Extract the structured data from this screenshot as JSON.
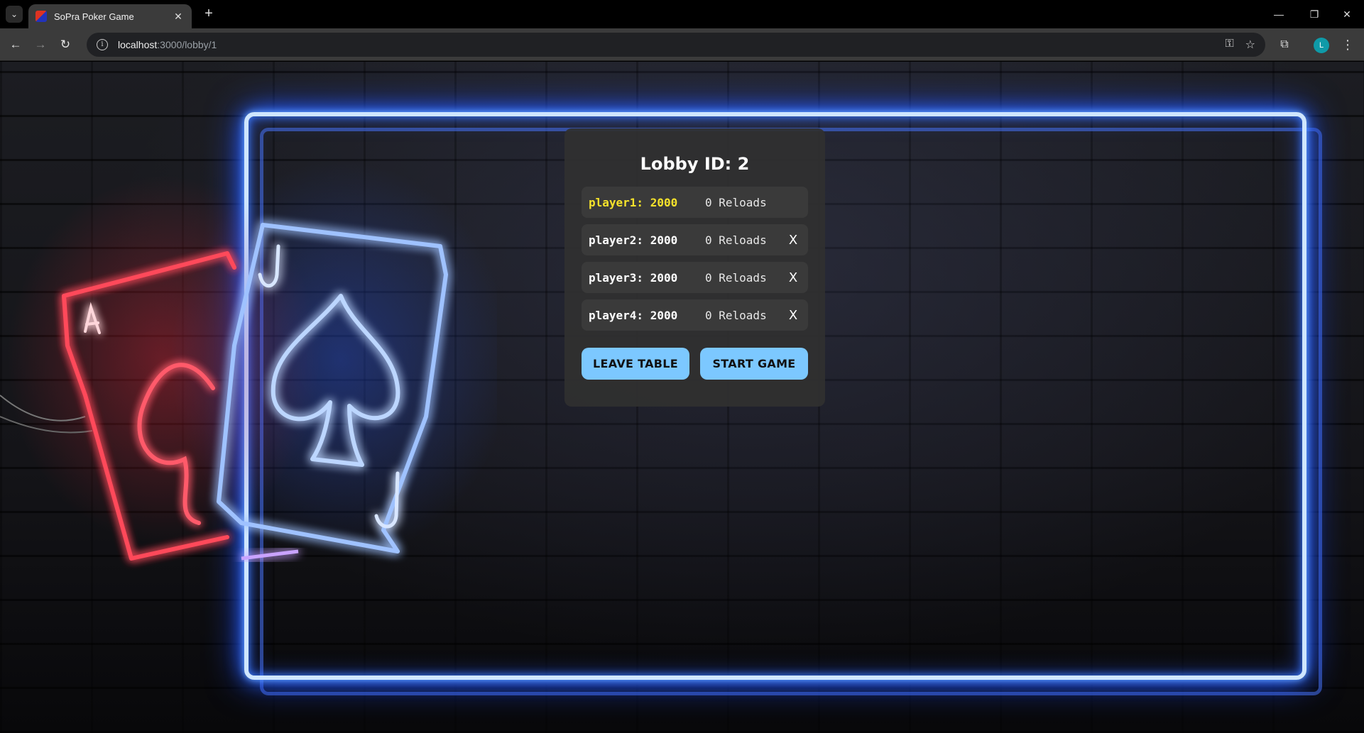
{
  "browser": {
    "tab_title": "SoPra Poker Game",
    "tab_close": "✕",
    "new_tab": "+",
    "url_host": "localhost",
    "url_path": ":3000/lobby/1",
    "profile_initial": "L",
    "window_controls": {
      "minimize": "—",
      "restore": "❐",
      "close": "✕"
    }
  },
  "lobby": {
    "title": "Lobby ID: 2",
    "players": [
      {
        "label": "player1: 2000",
        "reloads": "0 Reloads",
        "is_self": true,
        "kick": ""
      },
      {
        "label": "player2: 2000",
        "reloads": "0 Reloads",
        "is_self": false,
        "kick": "X"
      },
      {
        "label": "player3: 2000",
        "reloads": "0 Reloads",
        "is_self": false,
        "kick": "X"
      },
      {
        "label": "player4: 2000",
        "reloads": "0 Reloads",
        "is_self": false,
        "kick": "X"
      }
    ],
    "leave_label": "LEAVE TABLE",
    "start_label": "START GAME"
  },
  "colors": {
    "self_player": "#f5e22b",
    "button_bg": "#7cc8ff",
    "panel_bg": "#303030",
    "neon_blue": "#2f6bff",
    "neon_red": "#ff2a3a"
  },
  "icons": {
    "back": "back-arrow-icon",
    "forward": "forward-arrow-icon",
    "reload": "reload-icon",
    "info": "site-info-icon",
    "password": "key-icon",
    "bookmark": "star-icon",
    "extensions": "puzzle-icon",
    "menu": "kebab-menu-icon"
  }
}
